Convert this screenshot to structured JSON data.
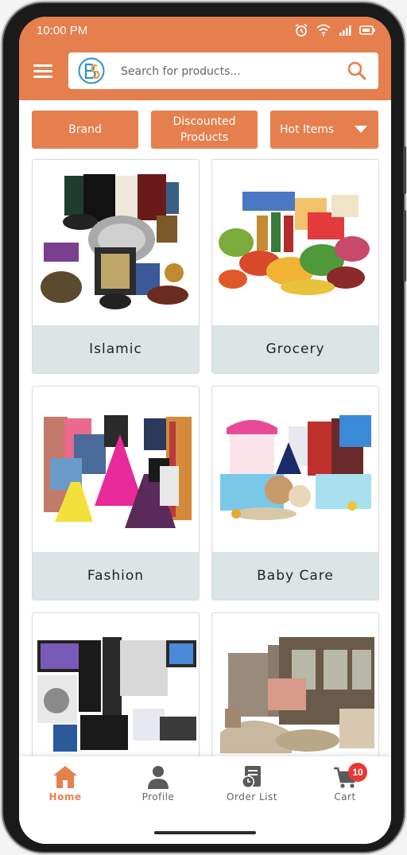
{
  "status_bar": {
    "time": "10:00 PM"
  },
  "search": {
    "placeholder": "Search for products..."
  },
  "filters": {
    "brand": "Brand",
    "discounted": "Discounted Products",
    "hot_items": "Hot Items"
  },
  "categories": [
    {
      "label": "Islamic"
    },
    {
      "label": "Grocery"
    },
    {
      "label": "Fashion"
    },
    {
      "label": "Baby Care"
    },
    {
      "label": ""
    },
    {
      "label": ""
    }
  ],
  "bottom_nav": {
    "home": "Home",
    "profile": "Profile",
    "order_list": "Order List",
    "cart": "Cart",
    "cart_count": "10"
  },
  "colors": {
    "accent": "#e67f4e",
    "card_label_bg": "#dbe5e6",
    "badge": "#e53935"
  },
  "icons": [
    "menu-icon",
    "logo-icon",
    "search-icon",
    "alarm-icon",
    "wifi-icon",
    "signal-icon",
    "battery-icon",
    "chevron-down-icon",
    "home-icon",
    "profile-icon",
    "order-list-icon",
    "cart-icon"
  ]
}
